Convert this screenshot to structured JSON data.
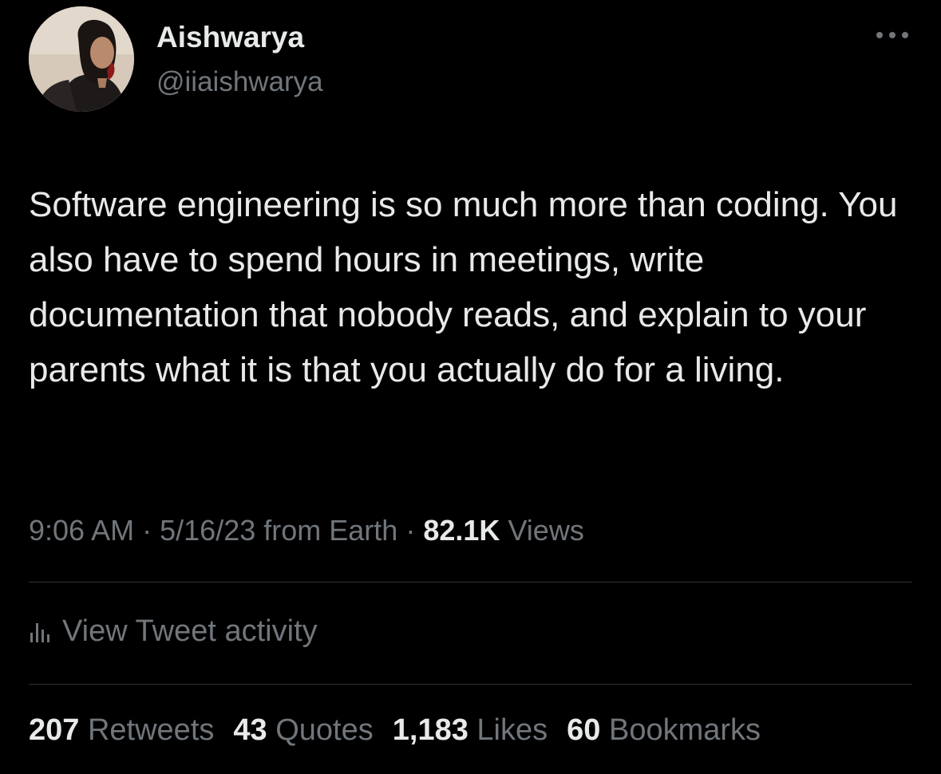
{
  "author": {
    "display_name": "Aishwarya",
    "handle": "@iiaishwarya",
    "avatar_icon": "profile-photo"
  },
  "tweet": {
    "text": "Software engineering is so much more than coding. You also have to spend hours in meetings, write documentation that nobody reads, and explain to your parents what it is that you actually do for a living."
  },
  "meta": {
    "time": "9:06 AM",
    "separator": "·",
    "date": "5/16/23",
    "source": "from Earth",
    "views_count": "82.1K",
    "views_label": "Views"
  },
  "activity": {
    "label": "View Tweet activity",
    "icon": "analytics-bars-icon"
  },
  "stats": {
    "retweets_count": "207",
    "retweets_label": "Retweets",
    "quotes_count": "43",
    "quotes_label": "Quotes",
    "likes_count": "1,183",
    "likes_label": "Likes",
    "bookmarks_count": "60",
    "bookmarks_label": "Bookmarks"
  },
  "colors": {
    "background": "#000000",
    "primary_text": "#e7e9ea",
    "secondary_text": "#71767b",
    "divider": "#2f3336"
  }
}
